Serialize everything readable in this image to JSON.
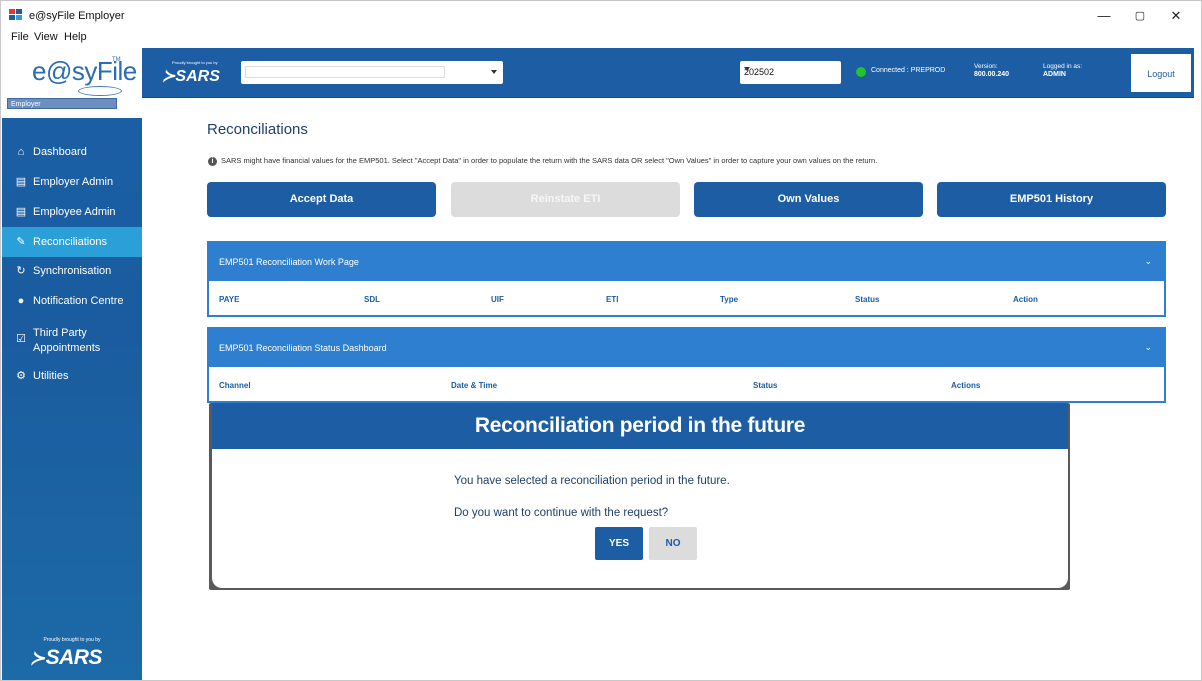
{
  "window": {
    "title": "e@syFile Employer",
    "minimize": "—",
    "restore": "▢",
    "close": "✕"
  },
  "menu": [
    "File",
    "View",
    "Help"
  ],
  "logo": {
    "text": "e@syFile",
    "tm": "TM",
    "badge": "Employer"
  },
  "sidebar": {
    "items": [
      {
        "label": "Dashboard",
        "icon": "home-icon"
      },
      {
        "label": "Employer Admin",
        "icon": "id-card-icon"
      },
      {
        "label": "Employee Admin",
        "icon": "id-card-icon"
      },
      {
        "label": "Reconciliations",
        "icon": "document-edit-icon",
        "active": true
      },
      {
        "label": "Synchronisation",
        "icon": "sync-icon"
      },
      {
        "label": "Notification Centre",
        "icon": "bell-icon"
      },
      {
        "label": "Third Party Appointments",
        "icon": "calendar-check-icon"
      },
      {
        "label": "Utilities",
        "icon": "gears-icon"
      }
    ],
    "footer_tagline": "Proudly brought to you by",
    "footer_brand": "SARS"
  },
  "header": {
    "tagline": "Proudly brought to you by",
    "brand": "SARS",
    "entity_select_value": "",
    "period_value": "202502",
    "connection_status": "Connected : PREPROD",
    "connection_color": "#22c32b",
    "version_label": "Version:",
    "version_value": "800.00.240",
    "logged_label": "Logged in as:",
    "logged_value": "ADMIN",
    "logout_label": "Logout"
  },
  "main": {
    "title": "Reconciliations",
    "info": "SARS might have financial values for the EMP501. Select \"Accept Data\" in order to populate the return with the SARS data OR select \"Own Values\" in order to capture your own values on the return.",
    "buttons": {
      "accept": "Accept Data",
      "reinstate": "Reinstate ETI",
      "own": "Own Values",
      "history": "EMP501 History"
    },
    "work_page": {
      "title": "EMP501 Reconciliation Work Page",
      "columns": [
        "PAYE",
        "SDL",
        "UIF",
        "ETI",
        "Type",
        "Status",
        "Action"
      ]
    },
    "status_dashboard": {
      "title": "EMP501 Reconciliation Status Dashboard",
      "columns": [
        "Channel",
        "Date & Time",
        "Status",
        "Actions"
      ]
    }
  },
  "modal": {
    "title": "Reconciliation period in the future",
    "message1": "You have selected a reconciliation period in the future.",
    "message2": "Do you want to continue with the request?",
    "yes": "YES",
    "no": "NO"
  },
  "colors": {
    "brand": "#1c5da4",
    "panel": "#2f7fd0",
    "active_nav": "#2a9fd8"
  }
}
